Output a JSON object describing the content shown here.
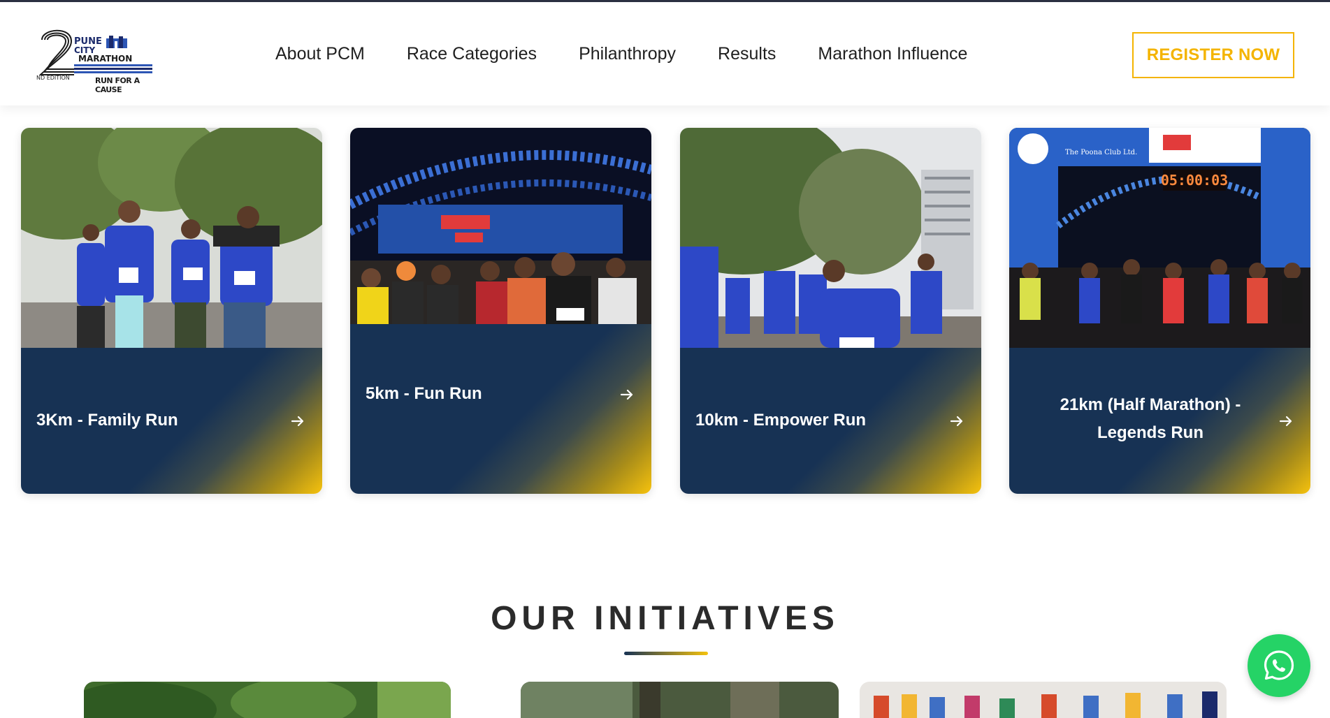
{
  "logo": {
    "edition_number": "2",
    "edition_label": "ND EDITION",
    "line1": "PUNE",
    "line2": "CITY",
    "line3": "MARATHON",
    "tagline": "RUN FOR A CAUSE"
  },
  "nav": {
    "items": [
      {
        "label": "About PCM"
      },
      {
        "label": "Race Categories"
      },
      {
        "label": "Philanthropy"
      },
      {
        "label": "Results"
      },
      {
        "label": "Marathon Influence"
      }
    ],
    "register_label": "REGISTER NOW"
  },
  "race_cards": [
    {
      "title": "3Km - Family Run",
      "photo": "runners-family-run-photo"
    },
    {
      "title": "5km - Fun Run",
      "photo": "runners-start-arch-night-photo"
    },
    {
      "title": "10km - Empower Run",
      "photo": "runners-empower-run-photo"
    },
    {
      "title_line1": "21km (Half Marathon) -",
      "title_line2": "Legends Run",
      "photo": "half-marathon-start-photo",
      "clock_text": "05:00:03",
      "banner_text": "The Poona Club Ltd."
    }
  ],
  "initiatives": {
    "heading": "OUR INITIATIVES"
  },
  "colors": {
    "navy": "#173254",
    "gold": "#f4b400",
    "whatsapp": "#25d366"
  },
  "icons": [
    "arrow-right-icon",
    "whatsapp-icon"
  ]
}
